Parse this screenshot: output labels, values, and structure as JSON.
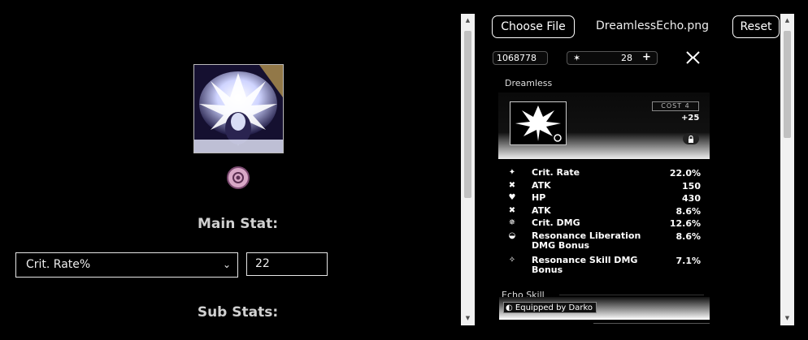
{
  "left_panel": {
    "main_stat_heading": "Main Stat:",
    "main_stat_select": "Crit. Rate%",
    "main_stat_value": "22",
    "sub_stats_heading": "Sub Stats:"
  },
  "file_bar": {
    "choose_file_label": "Choose File",
    "filename": "DreamlessEcho.png",
    "reset_label": "Reset"
  },
  "echo_card": {
    "uid": "1068778",
    "level_value": "28",
    "level_plus": "+",
    "name": "Dreamless",
    "cost_label": "COST",
    "cost_value": "4",
    "upgrade": "+25",
    "stats": [
      {
        "icon": "crit-rate-icon",
        "name": "Crit. Rate",
        "value": "22.0%"
      },
      {
        "icon": "atk-icon",
        "name": "ATK",
        "value": "150"
      },
      {
        "icon": "hp-icon",
        "name": "HP",
        "value": "430"
      },
      {
        "icon": "atk-icon",
        "name": "ATK",
        "value": "8.6%"
      },
      {
        "icon": "crit-dmg-icon",
        "name": "Crit. DMG",
        "value": "12.6%"
      },
      {
        "icon": "liberation-icon",
        "name": "Resonance Liberation DMG Bonus",
        "value": "8.6%"
      },
      {
        "icon": "skill-icon",
        "name": "Resonance Skill DMG Bonus",
        "value": "7.1%"
      }
    ],
    "echo_skill_label": "Echo Skill",
    "equipped_by": "Equipped by Darko"
  },
  "colors": {
    "background": "#000000",
    "sonata_badge": "#d9a8c7",
    "scrollbar_track": "#f1f1f1"
  }
}
